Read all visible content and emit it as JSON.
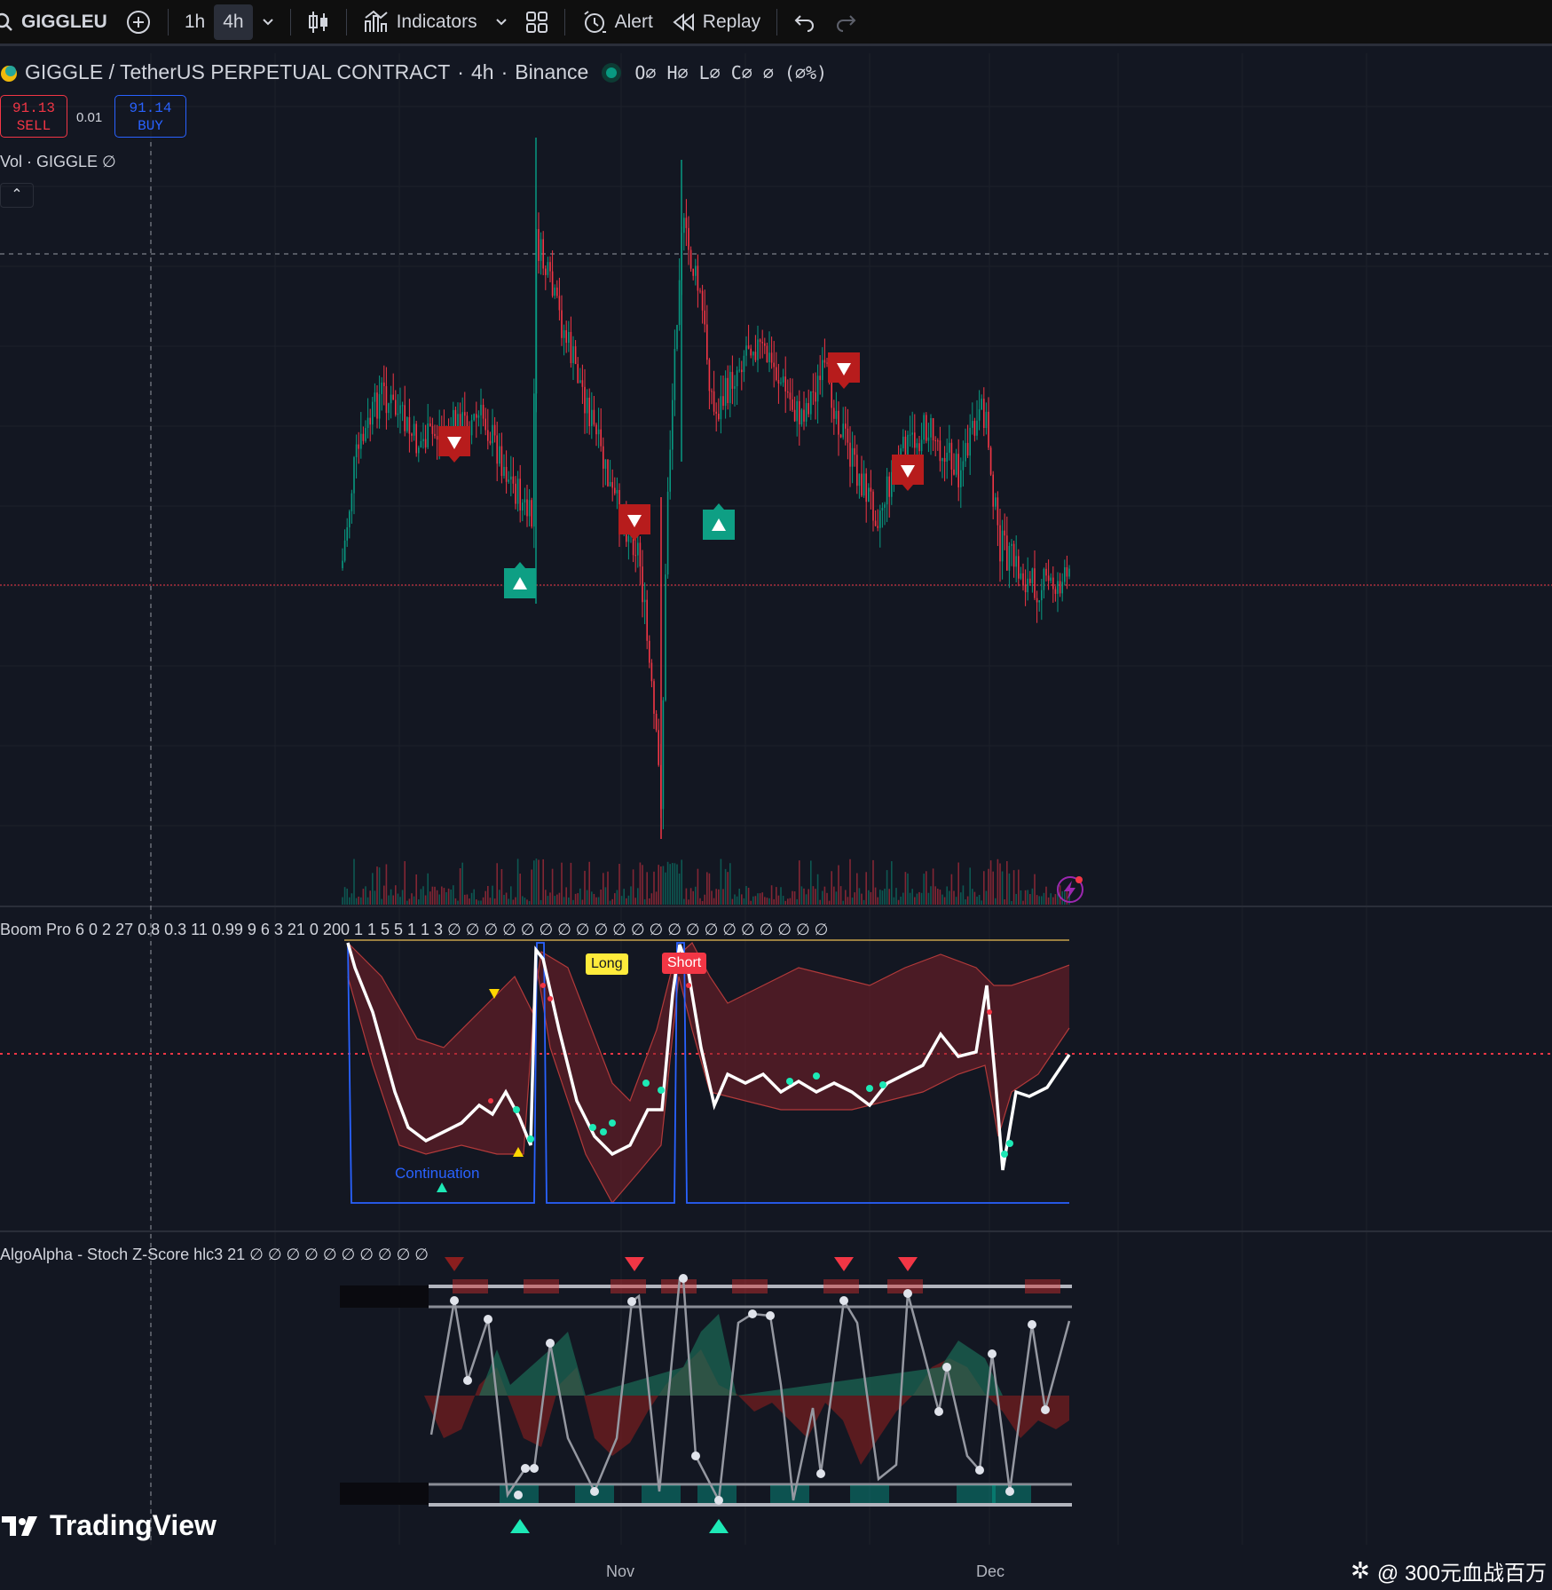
{
  "toolbar": {
    "symbol": "GIGGLEU",
    "timeframe_1h": "1h",
    "timeframe_4h": "4h",
    "indicators": "Indicators",
    "alert": "Alert",
    "replay": "Replay"
  },
  "legend": {
    "title": "GIGGLE / TetherUS PERPETUAL CONTRACT",
    "interval": "4h",
    "exchange": "Binance",
    "ohlc": "O∅ H∅ L∅ C∅ ∅ (∅%)"
  },
  "trade": {
    "sell_price": "91.13",
    "sell_label": "SELL",
    "spread": "0.01",
    "buy_price": "91.14",
    "buy_label": "BUY"
  },
  "volume_legend": "Vol · GIGGLE ∅",
  "boom_legend": "Boom Pro 6 0 2 27 0.8 0.3 11 0.99 9 6 3 21 0 200 1 1 5 5 1 1 3 ∅ ∅ ∅ ∅ ∅ ∅ ∅ ∅ ∅ ∅ ∅ ∅ ∅ ∅ ∅ ∅ ∅ ∅ ∅ ∅ ∅",
  "boom_labels": {
    "long": "Long",
    "short": "Short",
    "continuation": "Continuation"
  },
  "algo_legend": "AlgoAlpha - Stoch Z-Score hlc3 21 ∅ ∅ ∅ ∅ ∅ ∅ ∅ ∅ ∅ ∅",
  "x_axis": [
    "Nov",
    "Dec"
  ],
  "branding": "TradingView",
  "watermark": "@ 300元血战百万",
  "colors": {
    "background": "#131722",
    "up": "#089981",
    "down": "#f23645",
    "signal_short": "#b71c1c",
    "signal_long": "#0e9f84"
  },
  "chart_data": {
    "type": "candlestick",
    "price_signals": [
      {
        "type": "short",
        "x": "Oct 24"
      },
      {
        "type": "long",
        "x": "Oct 27"
      },
      {
        "type": "short",
        "x": "Oct 31"
      },
      {
        "type": "long",
        "x": "Nov 4"
      },
      {
        "type": "short",
        "x": "Nov 14"
      },
      {
        "type": "short",
        "x": "Nov 17"
      }
    ]
  }
}
